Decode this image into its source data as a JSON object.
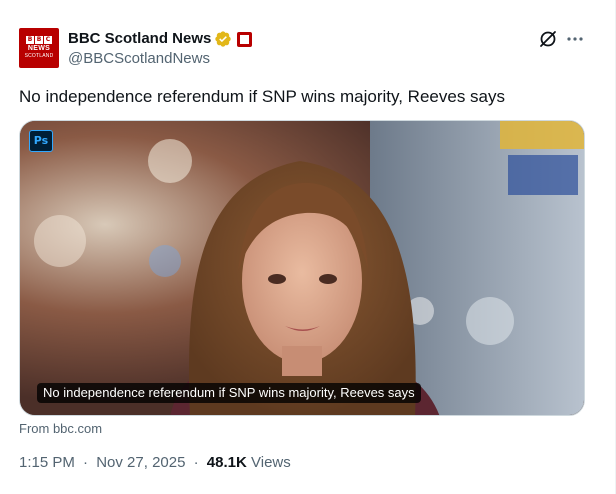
{
  "author": {
    "display_name": "BBC Scotland News",
    "handle": "@BBCScotlandNews",
    "avatar_text": [
      "B",
      "B",
      "C",
      "NEWS",
      "SCOTLAND"
    ]
  },
  "tweet": {
    "text": "No independence referendum if SNP wins majority, Reeves says"
  },
  "media": {
    "badge": "Ps",
    "caption": "No independence referendum if SNP wins majority, Reeves says",
    "source": "From bbc.com"
  },
  "meta": {
    "time": "1:15 PM",
    "separator": "·",
    "date": "Nov 27, 2025",
    "views_count": "48.1K",
    "views_label": "Views"
  },
  "colors": {
    "brand_red": "#b80000",
    "verified_gold": "#e2b719",
    "secondary_text": "#536471",
    "primary_text": "#0f1419"
  }
}
